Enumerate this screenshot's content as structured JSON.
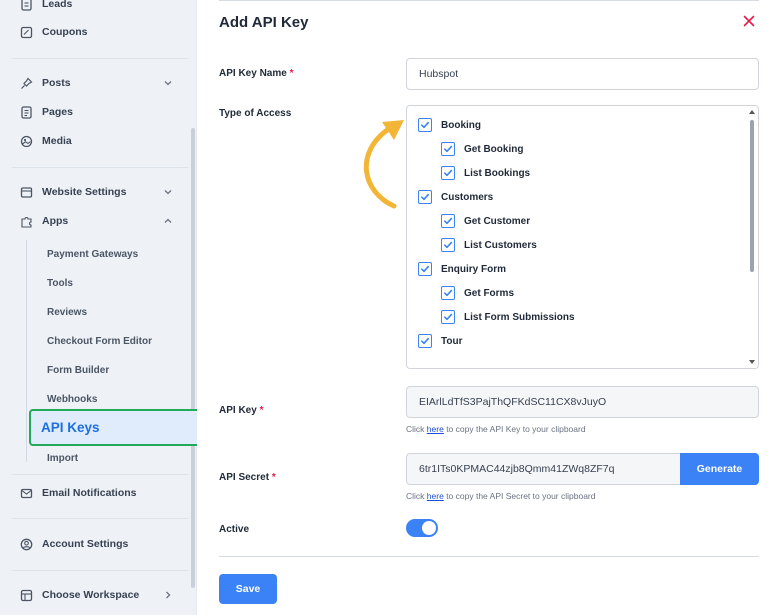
{
  "sidebar": {
    "leads": "Leads",
    "coupons": "Coupons",
    "posts": "Posts",
    "pages": "Pages",
    "media": "Media",
    "website_settings": "Website Settings",
    "apps": "Apps",
    "sub_items": [
      "Payment Gateways",
      "Tools",
      "Reviews",
      "Checkout Form Editor",
      "Form Builder",
      "Webhooks"
    ],
    "api_keys": "API Keys",
    "import": "Import",
    "email_notifications": "Email Notifications",
    "account_settings": "Account Settings",
    "choose_workspace": "Choose Workspace"
  },
  "modal": {
    "title": "Add API Key",
    "api_key_name_label": "API Key Name",
    "api_key_name_value": "Hubspot",
    "type_of_access_label": "Type of Access",
    "access": [
      {
        "label": "Booking",
        "checked": true,
        "level": 0
      },
      {
        "label": "Get Booking",
        "checked": true,
        "level": 1
      },
      {
        "label": "List Bookings",
        "checked": true,
        "level": 1
      },
      {
        "label": "Customers",
        "checked": true,
        "level": 0
      },
      {
        "label": "Get Customer",
        "checked": true,
        "level": 1
      },
      {
        "label": "List Customers",
        "checked": true,
        "level": 1
      },
      {
        "label": "Enquiry Form",
        "checked": true,
        "level": 0
      },
      {
        "label": "Get Forms",
        "checked": true,
        "level": 1
      },
      {
        "label": "List Form Submissions",
        "checked": true,
        "level": 1
      },
      {
        "label": "Tour",
        "checked": true,
        "level": 0
      }
    ],
    "api_key_label": "API Key",
    "api_key_value": "EIArlLdTfS3PajThQFKdSC11CX8vJuyO",
    "api_key_hint_pre": "Click",
    "api_key_hint_link": "here",
    "api_key_hint_post": "to copy the API Key to your clipboard",
    "api_secret_label": "API Secret",
    "api_secret_value": "6tr1ITs0KPMAC44zjb8Qmm41ZWq8ZF7q",
    "generate_label": "Generate",
    "api_secret_hint_pre": "Click",
    "api_secret_hint_link": "here",
    "api_secret_hint_post": "to copy the API Secret to your clipboard",
    "active_label": "Active",
    "active_on": true,
    "save_label": "Save",
    "required_mark": "*"
  },
  "colors": {
    "accent": "#3b82f6",
    "highlight_border": "#22a95a",
    "annotation_arrow": "#f2b535",
    "close_x": "#e11d48"
  }
}
